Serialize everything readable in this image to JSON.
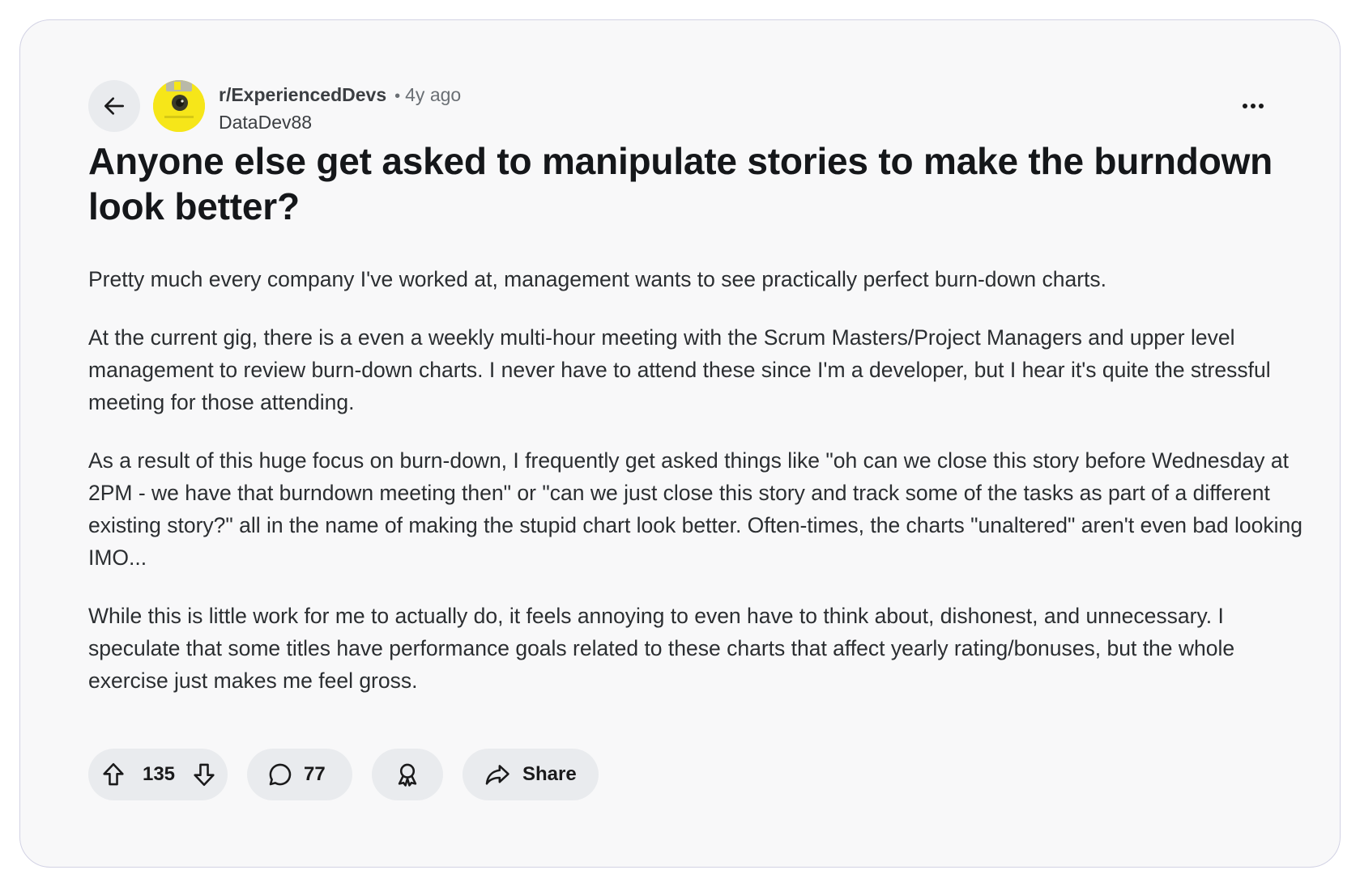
{
  "post": {
    "subreddit": "r/ExperiencedDevs",
    "separator": "•",
    "time": "4y ago",
    "author": "DataDev88",
    "title": "Anyone else get asked to manipulate stories to make the burndown look better?",
    "paragraphs": [
      "Pretty much every company I've worked at, management wants to see practically perfect burn-down charts.",
      "At the current gig, there is a even a weekly multi-hour meeting with the Scrum Masters/Project Managers and upper level management to review burn-down charts. I never have to attend these since I'm a developer, but I hear it's quite the stressful meeting for those attending.",
      "As a result of this huge focus on burn-down, I frequently get asked things like \"oh can we close this story before Wednesday at 2PM - we have that burndown meeting then\" or \"can we just close this story and track some of the tasks as part of a different existing story?\" all in the name of making the stupid chart look better. Often-times, the charts \"unaltered\" aren't even bad looking IMO...",
      "While this is little work for me to actually do, it feels annoying to even have to think about, dishonest, and unnecessary. I speculate that some titles have performance goals related to these charts that affect yearly rating/bonuses, but the whole exercise just makes me feel gross."
    ]
  },
  "actions": {
    "votes": "135",
    "comments": "77",
    "share_label": "Share"
  },
  "icons": {
    "back": "arrow-left-icon",
    "more": "more-horizontal-icon",
    "upvote": "arrow-up-icon",
    "downvote": "arrow-down-icon",
    "comment": "speech-bubble-icon",
    "award": "award-ribbon-icon",
    "share": "share-arrow-icon"
  },
  "colors": {
    "card_background": "#f8f8f9",
    "card_border": "#d2d2e4",
    "pill_background": "#e9ebee",
    "avatar_yellow": "#f6e619",
    "title_text": "#15171a",
    "body_text": "#2b2e31",
    "meta_text": "#6a6f74"
  }
}
